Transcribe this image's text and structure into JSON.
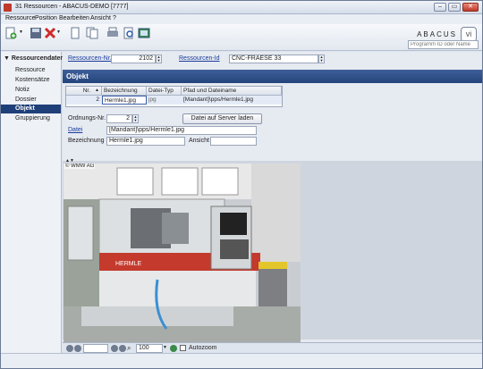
{
  "window": {
    "title": "31 Ressourcen - ABACUS-DEMO [7777]",
    "minimize": "–",
    "maximize": "▭",
    "close": "✕"
  },
  "menu": {
    "items": [
      "Ressource",
      "Position",
      "Bearbeiten",
      "Ansicht",
      "?"
    ]
  },
  "brand": {
    "name": "ABACUS",
    "mark": "vi"
  },
  "program_search": {
    "placeholder": "Programm ID oder Name"
  },
  "sidebar": {
    "header": "Ressourcendaten",
    "items": [
      {
        "label": "Ressource"
      },
      {
        "label": "Kostensätze"
      },
      {
        "label": "Notiz"
      },
      {
        "label": "Dossier"
      },
      {
        "label": "Objekt"
      },
      {
        "label": "Gruppierung"
      }
    ],
    "selected": "Objekt"
  },
  "header_fields": {
    "resource_nr_label": "Ressourcen-Nr.",
    "resource_nr_value": "2102",
    "resource_id_label": "Ressourcen-Id",
    "resource_id_value": "CNC-FRAESE 33"
  },
  "section": {
    "title": "Objekt"
  },
  "table": {
    "columns": [
      "Nr.",
      "Bezeichnung",
      "Datei-Typ",
      "Pfad und Dateiname"
    ],
    "rows": [
      {
        "nr": "2",
        "bezeichnung": "Hermle1.jpg",
        "typ": "jpg",
        "pfad": "[Mandant]\\pps/Hermle1.jpg"
      }
    ]
  },
  "detail": {
    "ordnungs_label": "Ordnungs-Nr.",
    "ordnungs_value": "2",
    "upload_button": "Datei auf Server laden",
    "datei_label": "Datei",
    "datei_value": "[Mandant]\\pps/Hermle1.jpg",
    "bezeichnung_label": "Bezeichnung",
    "bezeichnung_value": "Hermle1.jpg",
    "ansicht_label": "Ansicht",
    "ansicht_value": ""
  },
  "viewer": {
    "credit": "© WMW AG"
  },
  "viewer_controls": {
    "zoom_value": "100",
    "autozoom_label": "Autozoom"
  }
}
